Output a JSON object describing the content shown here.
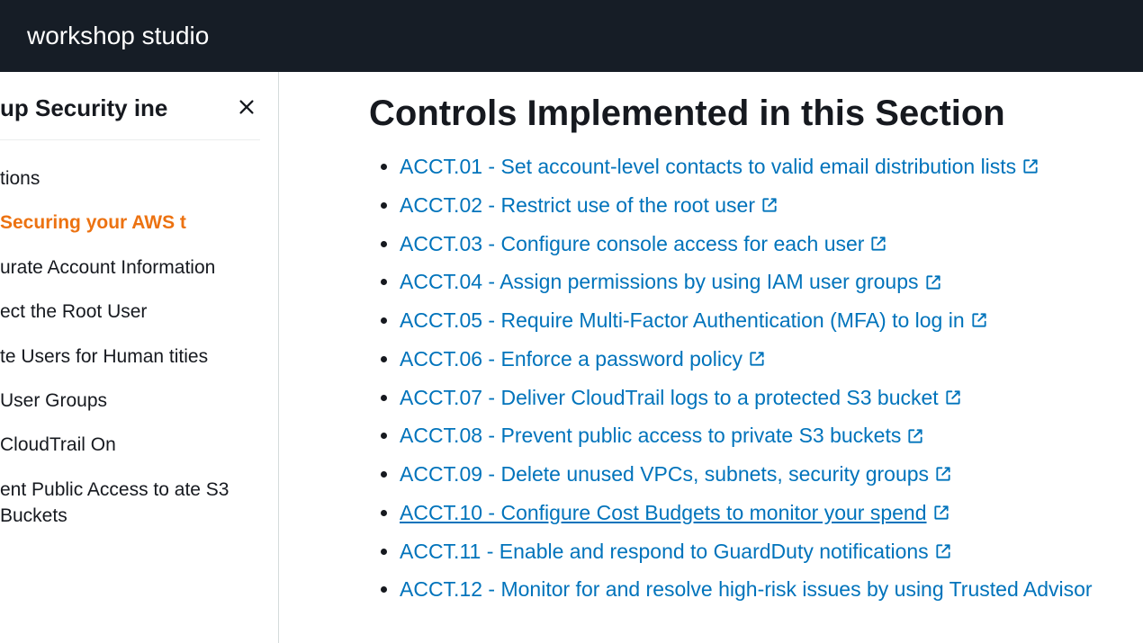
{
  "header": {
    "title": "workshop studio"
  },
  "sidebar": {
    "title": "up Security ine",
    "items": [
      {
        "label": "tions",
        "active": false
      },
      {
        "label": "Securing your AWS t",
        "active": true
      },
      {
        "label": "urate Account Information",
        "active": false
      },
      {
        "label": "ect the Root User",
        "active": false
      },
      {
        "label": "te Users for Human tities",
        "active": false
      },
      {
        "label": "User Groups",
        "active": false
      },
      {
        "label": "CloudTrail On",
        "active": false
      },
      {
        "label": "ent Public Access to ate S3 Buckets",
        "active": false
      }
    ]
  },
  "main": {
    "heading": "Controls Implemented in this Section",
    "controls": [
      {
        "text": "ACCT.01 - Set account-level contacts to valid email distribution lists",
        "external": true,
        "hovered": false
      },
      {
        "text": "ACCT.02 - Restrict use of the root user",
        "external": true,
        "hovered": false
      },
      {
        "text": "ACCT.03 - Configure console access for each user",
        "external": true,
        "hovered": false
      },
      {
        "text": "ACCT.04 - Assign permissions by using IAM user groups",
        "external": true,
        "hovered": false
      },
      {
        "text": "ACCT.05 - Require Multi-Factor Authentication (MFA) to log in",
        "external": true,
        "hovered": false
      },
      {
        "text": "ACCT.06 - Enforce a password policy",
        "external": true,
        "hovered": false
      },
      {
        "text": "ACCT.07 - Deliver CloudTrail logs to a protected S3 bucket",
        "external": true,
        "hovered": false
      },
      {
        "text": "ACCT.08 - Prevent public access to private S3 buckets",
        "external": true,
        "hovered": false
      },
      {
        "text": "ACCT.09 - Delete unused VPCs, subnets, security groups",
        "external": true,
        "hovered": false
      },
      {
        "text": "ACCT.10 - Configure Cost Budgets to monitor your spend ",
        "external": true,
        "hovered": true
      },
      {
        "text": "ACCT.11 - Enable and respond to GuardDuty notifications",
        "external": true,
        "hovered": false
      },
      {
        "text": "ACCT.12 - Monitor for and resolve high-risk issues by using Trusted Advisor",
        "external": false,
        "hovered": false
      }
    ]
  }
}
